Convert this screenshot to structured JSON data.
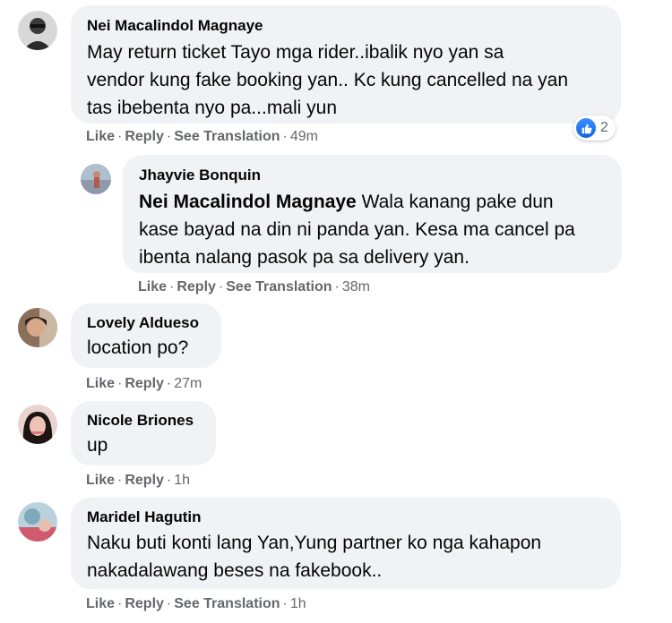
{
  "actions": {
    "like": "Like",
    "reply": "Reply",
    "see_translation": "See Translation",
    "separator": "·"
  },
  "comments": [
    {
      "author": "Nei Macalindol Magnaye",
      "lines": [
        "May return ticket Tayo mga rider..ibalik nyo yan sa",
        "vendor kung fake booking yan.. Kc kung cancelled na yan",
        "tas ibebenta nyo pa...mali yun"
      ],
      "time": "49m",
      "reaction_count": "2",
      "reaction_icon": "like-icon"
    },
    {
      "author": "Jhayvie Bonquin",
      "mention": "Nei Macalindol Magnaye",
      "line1_rest": " Wala kanang pake dun",
      "lines": [
        "kase bayad na din ni panda yan. Kesa ma cancel pa",
        "ibenta nalang pasok pa sa delivery yan."
      ],
      "time": "38m"
    },
    {
      "author": "Lovely Aldueso",
      "lines": [
        "location po?"
      ],
      "time": "27m"
    },
    {
      "author": "Nicole Briones",
      "lines": [
        "up"
      ],
      "time": "1h"
    },
    {
      "author": "Maridel Hagutin",
      "lines": [
        "Naku buti konti lang Yan,Yung partner ko nga kahapon",
        "nakadalawang beses na fakebook.."
      ],
      "time": "1h"
    }
  ],
  "colors": {
    "bubble": "#f0f2f5",
    "meta_text": "#65676b",
    "like_blue": "#1877f2"
  }
}
